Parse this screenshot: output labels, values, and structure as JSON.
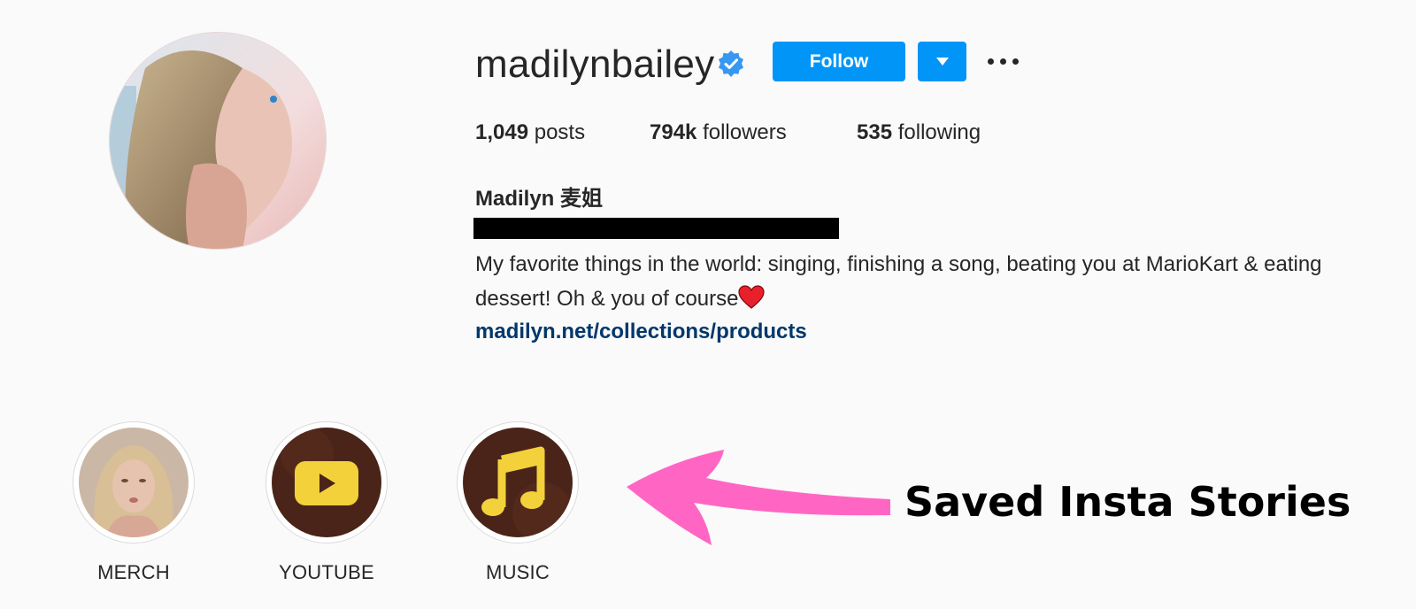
{
  "profile": {
    "username": "madilynbailey",
    "full_name": "Madilyn 麦姐",
    "bio": "My favorite things in the world: singing, finishing a song, beating you at MarioKart & eating dessert! Oh & you of course",
    "link": "madilyn.net/collections/products"
  },
  "actions": {
    "follow_label": "Follow"
  },
  "stats": {
    "posts_count": "1,049",
    "posts_label": "posts",
    "followers_count": "794k",
    "followers_label": "followers",
    "following_count": "535",
    "following_label": "following"
  },
  "highlights": [
    {
      "label": "MERCH"
    },
    {
      "label": "YOUTUBE"
    },
    {
      "label": "MUSIC"
    }
  ],
  "annotation": {
    "text": "Saved Insta Stories"
  },
  "icons": {
    "verified": "verified-badge-icon",
    "dropdown": "chevron-down-icon",
    "more": "more-options-icon",
    "heart": "heart-icon",
    "youtube": "youtube-play-icon",
    "music": "music-note-icon"
  },
  "colors": {
    "accent": "#0095f6",
    "link": "#00376b",
    "arrow": "#ff66c4",
    "highlight_bg": "#4a2418",
    "highlight_icon": "#f2d13b"
  }
}
